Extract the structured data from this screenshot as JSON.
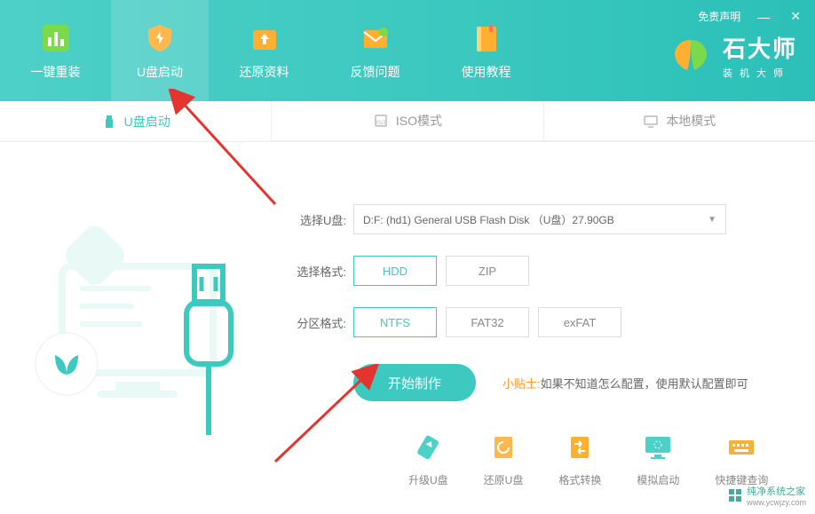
{
  "header": {
    "disclaimer": "免责声明",
    "nav": [
      {
        "label": "一键重装",
        "id": "reinstall"
      },
      {
        "label": "U盘启动",
        "id": "usb-boot"
      },
      {
        "label": "还原资料",
        "id": "restore"
      },
      {
        "label": "反馈问题",
        "id": "feedback"
      },
      {
        "label": "使用教程",
        "id": "tutorial"
      }
    ],
    "brand": {
      "title": "石大师",
      "subtitle": "装机大师"
    }
  },
  "subTabs": {
    "usb": "U盘启动",
    "iso": "ISO模式",
    "local": "本地模式"
  },
  "form": {
    "selectUsb": {
      "label": "选择U盘:",
      "value": "D:F: (hd1) General USB Flash Disk （U盘）27.90GB"
    },
    "selectFormat": {
      "label": "选择格式:",
      "options": [
        "HDD",
        "ZIP"
      ],
      "selected": 0
    },
    "partitionFormat": {
      "label": "分区格式:",
      "options": [
        "NTFS",
        "FAT32",
        "exFAT"
      ],
      "selected": 0
    },
    "startBtn": "开始制作",
    "tip": {
      "label": "小贴士:",
      "text": "如果不知道怎么配置，使用默认配置即可"
    }
  },
  "tools": [
    {
      "label": "升级U盘",
      "id": "upgrade-usb"
    },
    {
      "label": "还原U盘",
      "id": "restore-usb"
    },
    {
      "label": "格式转换",
      "id": "format-convert"
    },
    {
      "label": "模拟启动",
      "id": "simulate-boot"
    },
    {
      "label": "快捷键查询",
      "id": "hotkey-query"
    }
  ],
  "watermark": {
    "name": "纯净系统之家",
    "url": "www.ycwjzy.com"
  },
  "colors": {
    "primary": "#3dc9c0",
    "accent": "#ff9933"
  }
}
